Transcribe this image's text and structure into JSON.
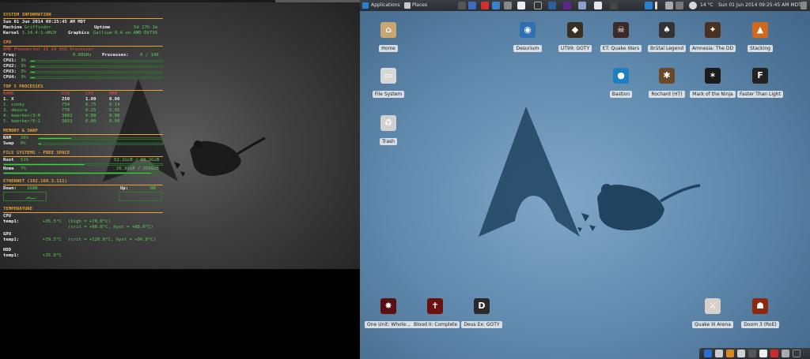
{
  "conky": {
    "system": {
      "heading": "SYSTEM INFORMATION",
      "datetime": "Sun 01 Jun 2014 09:25:45 AM MDT",
      "machine_label": "Machine",
      "machine_value": "Griffindor",
      "uptime_label": "Uptime",
      "uptime_value": "5d 17h 1m",
      "kernel_label": "Kernel",
      "kernel_value": "3.14.4-1-ARCH",
      "graphics_label": "Graphics",
      "graphics_value": "Gallium 0.4 on AMD RV730"
    },
    "cpu": {
      "heading": "CPU",
      "model": "AMD Phenom(tm) II X4 955 Processor",
      "freq_label": "Freq:",
      "freq_value": "0.80GHz",
      "processes_label": "Processes:",
      "processes_value": "0 / 148",
      "cores": [
        {
          "label": "CPU1:",
          "value": "3%",
          "fill": 0.03
        },
        {
          "label": "CPU2:",
          "value": "3%",
          "fill": 0.03
        },
        {
          "label": "CPU3:",
          "value": "3%",
          "fill": 0.03
        },
        {
          "label": "CPU4:",
          "value": "3%",
          "fill": 0.03
        }
      ]
    },
    "top": {
      "heading": "TOP 5 PROCESSES",
      "columns": [
        "NAME",
        "PID",
        "CPU",
        "MEM"
      ],
      "rows": [
        [
          "1. X",
          "250",
          "1.00",
          "0.08"
        ],
        [
          "2. conky",
          "754",
          "0.75",
          "0.14"
        ],
        [
          "3. desura",
          "776",
          "0.25",
          "5.05"
        ],
        [
          "4. kworker/3:0",
          "3862",
          "0.00",
          "0.00"
        ],
        [
          "5. kworker/0:1",
          "3853",
          "0.00",
          "0.00"
        ]
      ]
    },
    "memory": {
      "heading": "MEMORY & SWAP",
      "ram_label": "RAM",
      "ram_value": "26%",
      "ram_fill": 0.26,
      "swap_label": "Swap",
      "swap_value": "0%",
      "swap_fill": 0
    },
    "filesystems": {
      "heading": "FILE SYSTEMS - FREE SPACE",
      "root_label": "Root",
      "root_pct": "51%",
      "root_value": "51.1GiB / 99.2GiB",
      "root_fill": 0.51,
      "home_label": "Home",
      "home_pct": "7%",
      "home_value": "26.9GiB / 356GiB",
      "home_fill": 0.93
    },
    "ethernet": {
      "heading": "ETHERNET (192.168.3.111)",
      "down_label": "Down:",
      "down_value": "168B",
      "up_label": "Up:",
      "up_value": "0B"
    },
    "temperature": {
      "heading": "TEMPERATURE",
      "cpu_heading": "CPU",
      "cpu_label": "temp1:",
      "cpu_value": "+35.5°C",
      "cpu_limits1": "(high = +70.0°C)",
      "cpu_limits2": "(crit = +90.0°C, hyst = +88.0°C)",
      "gpu_heading": "GPU",
      "gpu_label": "temp1:",
      "gpu_value": "+39.5°C",
      "gpu_limits": "(crit = +120.0°C, hyst = +90.0°C)",
      "hdd_heading": "HDD",
      "hdd_label": "temp1:",
      "hdd_value": "+35.0°C"
    }
  },
  "panel": {
    "applications_label": "Applications",
    "places_label": "Places",
    "weather": "14 °C",
    "clock": "Sun 01 Jun 2014 09:25:45 AM MDT"
  },
  "desktop_icons": [
    {
      "id": "home",
      "label": "Home",
      "icon": "home-folder-icon",
      "color": "#c9a670"
    },
    {
      "id": "desurium",
      "label": "Desurium",
      "icon": "desurium-icon",
      "color": "#2d6fb0"
    },
    {
      "id": "ut99",
      "label": "UT99: GOTY",
      "icon": "ut99-icon",
      "color": "#3a3022"
    },
    {
      "id": "etqw",
      "label": "ET: Quake Wars",
      "icon": "quake-wars-icon",
      "color": "#3a2a2a"
    },
    {
      "id": "brutal",
      "label": "Brütal Legend",
      "icon": "brutal-legend-icon",
      "color": "#333333"
    },
    {
      "id": "amnesia",
      "label": "Amnesia: The DD",
      "icon": "amnesia-icon",
      "color": "#4a3020"
    },
    {
      "id": "stacking",
      "label": "Stacking",
      "icon": "stacking-icon",
      "color": "#d06a1a"
    },
    {
      "id": "filesystem",
      "label": "File System",
      "icon": "hard-drive-icon",
      "color": "#d8d8d8"
    },
    {
      "id": "bastion",
      "label": "Bastion",
      "icon": "bastion-icon",
      "color": "#1f7fbf"
    },
    {
      "id": "rochard",
      "label": "Rochard (HT)",
      "icon": "rochard-icon",
      "color": "#6a4a2a"
    },
    {
      "id": "ninja",
      "label": "Mark of the Ninja",
      "icon": "ninja-icon",
      "color": "#1a1a1a"
    },
    {
      "id": "ftl",
      "label": "Faster Than Light",
      "icon": "ftl-icon",
      "color": "#222222"
    },
    {
      "id": "trash",
      "label": "Trash",
      "icon": "trash-icon",
      "color": "#d0d0d0"
    },
    {
      "id": "oneunit",
      "label": "One Unit: Whole...",
      "icon": "one-unit-icon",
      "color": "#5a1010"
    },
    {
      "id": "blood2",
      "label": "Blood II: Complete",
      "icon": "blood-icon",
      "color": "#6a1212"
    },
    {
      "id": "deusex",
      "label": "Deus Ex: GOTY",
      "icon": "deus-ex-icon",
      "color": "#2a2a2a"
    },
    {
      "id": "quake3",
      "label": "Quake III Arena",
      "icon": "quake3-icon",
      "color": "#d8d0c8"
    },
    {
      "id": "doom3",
      "label": "Doom 3 (RoE)",
      "icon": "doom3-icon",
      "color": "#8a2a10"
    }
  ],
  "colors": {
    "conky_heading": "#e8a030",
    "conky_value": "#58d058",
    "panel": "#2f3338",
    "desktop": "#5f89ad"
  }
}
